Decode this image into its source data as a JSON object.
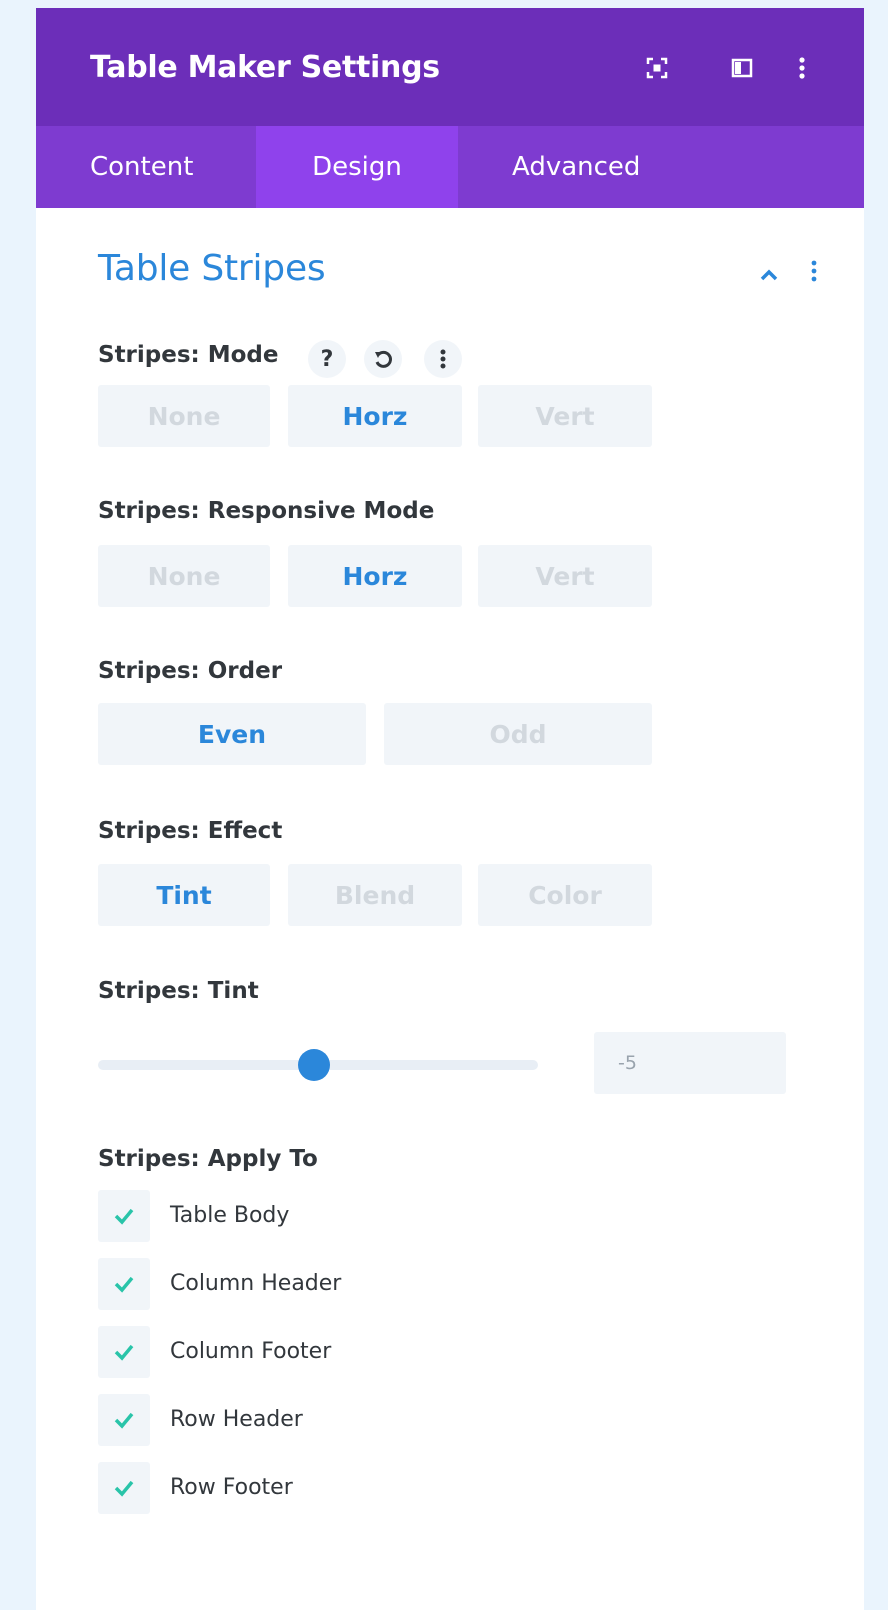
{
  "header": {
    "title": "Table Maker Settings"
  },
  "tabs": [
    {
      "label": "Content",
      "active": false
    },
    {
      "label": "Design",
      "active": true
    },
    {
      "label": "Advanced",
      "active": false
    }
  ],
  "section": {
    "title": "Table Stripes"
  },
  "mode": {
    "label": "Stripes: Mode",
    "help": "?",
    "options": [
      "None",
      "Horz",
      "Vert"
    ],
    "selected": "Horz"
  },
  "responsive": {
    "label": "Stripes: Responsive Mode",
    "options": [
      "None",
      "Horz",
      "Vert"
    ],
    "selected": "Horz"
  },
  "order": {
    "label": "Stripes: Order",
    "options": [
      "Even",
      "Odd"
    ],
    "selected": "Even"
  },
  "effect": {
    "label": "Stripes: Effect",
    "options": [
      "Tint",
      "Blend",
      "Color"
    ],
    "selected": "Tint"
  },
  "tint": {
    "label": "Stripes: Tint",
    "value": "-5",
    "slider_fraction": 0.49
  },
  "apply": {
    "label": "Stripes: Apply To",
    "items": [
      {
        "label": "Table Body",
        "checked": true
      },
      {
        "label": "Column Header",
        "checked": true
      },
      {
        "label": "Column Footer",
        "checked": true
      },
      {
        "label": "Row Header",
        "checked": true
      },
      {
        "label": "Row Footer",
        "checked": true
      }
    ]
  },
  "colors": {
    "header_bg": "#6c2eb9",
    "tabs_bg": "#7e3bd0",
    "active_tab_bg": "#8f42ec",
    "accent": "#2b87da",
    "check": "#29c4a9",
    "button_bg": "#f1f5f9",
    "page_bg": "#eaf4fd"
  },
  "icons": {
    "header": [
      "expand-icon",
      "sidebar-layout-icon",
      "more-vertical-icon"
    ],
    "section": [
      "chevron-up-icon",
      "more-vertical-icon"
    ],
    "mode": [
      "help-icon",
      "reset-icon",
      "more-vertical-icon"
    ],
    "check": "check-icon"
  }
}
